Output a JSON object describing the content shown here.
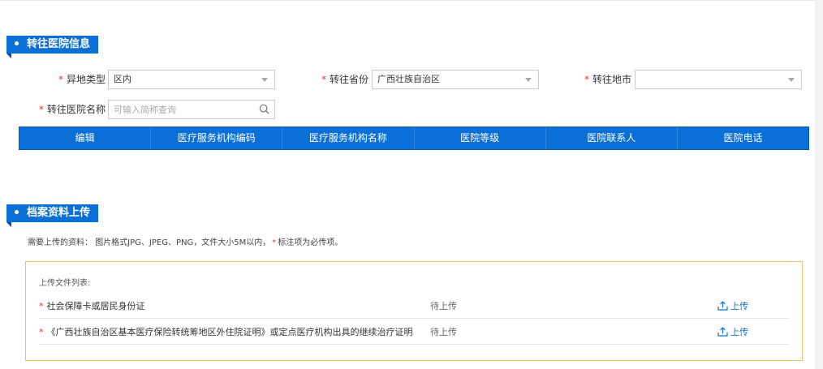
{
  "hospital_section": {
    "title": "转往医院信息"
  },
  "form": {
    "location_type": {
      "label": "异地类型",
      "value": "区内"
    },
    "province": {
      "label": "转往省份",
      "value": "广西壮族自治区"
    },
    "city": {
      "label": "转往地市",
      "value": ""
    },
    "hospital_name": {
      "label": "转往医院名称",
      "placeholder": "可输入简称查询"
    }
  },
  "table": {
    "columns": [
      "编辑",
      "医疗服务机构编码",
      "医疗服务机构名称",
      "医院等级",
      "医院联系人",
      "医院电话"
    ]
  },
  "archive_section": {
    "title": "档案资料上传",
    "hint_prefix": "需要上传的资料：  图片格式JPG、JPEG、PNG，文件大小5M以内，",
    "hint_star": "*",
    "hint_suffix": "标注项为必传项。"
  },
  "upload": {
    "list_title": "上传文件列表:",
    "required_mark": "*",
    "files": [
      {
        "name": "社会保障卡或居民身份证",
        "status": "待上传",
        "action": "上传"
      },
      {
        "name": "《广西壮族自治区基本医疗保险转统筹地区外住院证明》或定点医疗机构出具的继续治疗证明",
        "status": "待上传",
        "action": "上传"
      }
    ]
  },
  "colors": {
    "primary": "#0a6fd6",
    "required": "#e33333",
    "upload_border": "#f0c36a"
  }
}
